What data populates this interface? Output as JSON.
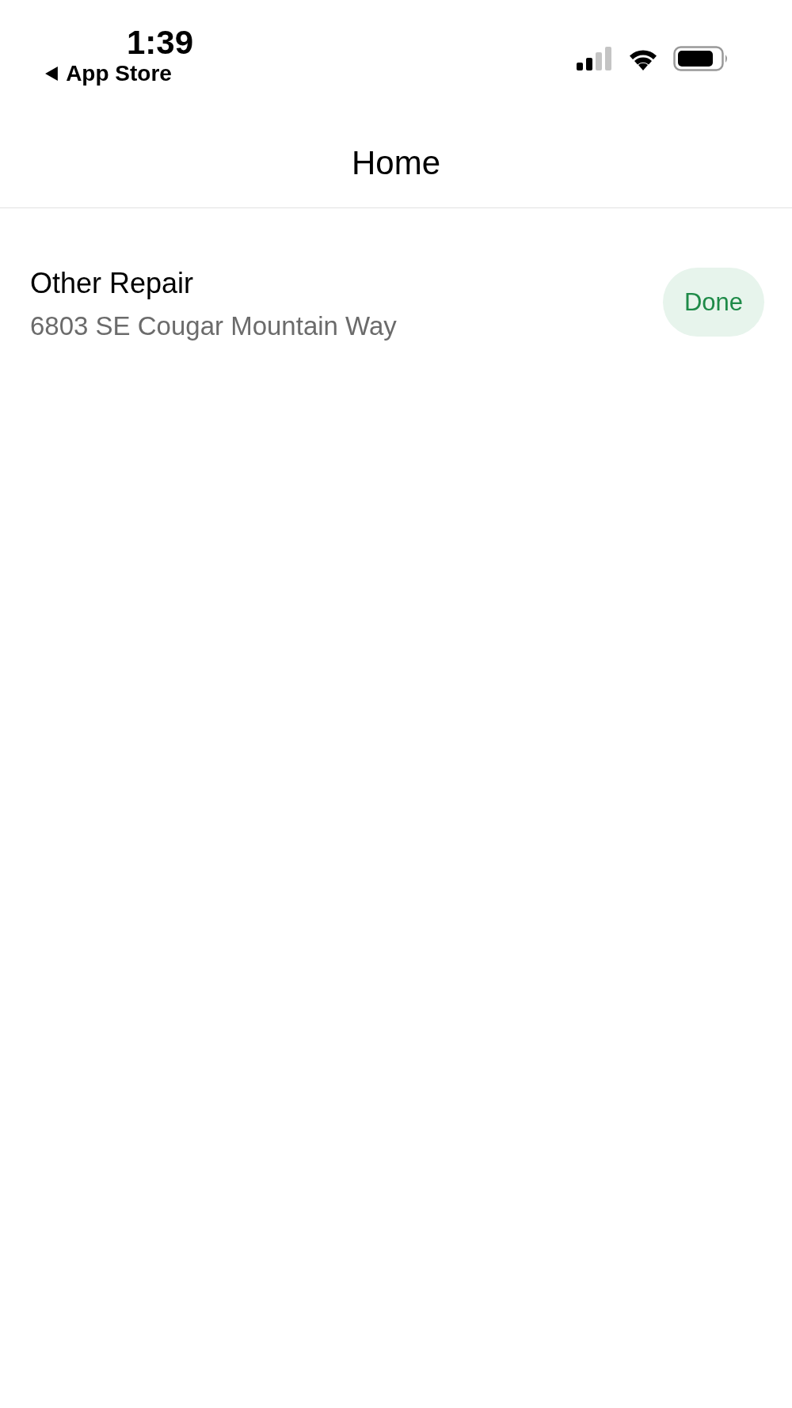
{
  "status_bar": {
    "time": "1:39",
    "back_label": "App Store"
  },
  "nav_bar": {
    "title": "Home"
  },
  "jobs": [
    {
      "title": "Other Repair",
      "address": "6803 SE Cougar Mountain Way",
      "status": {
        "kind": "done",
        "label": "Done"
      }
    }
  ]
}
